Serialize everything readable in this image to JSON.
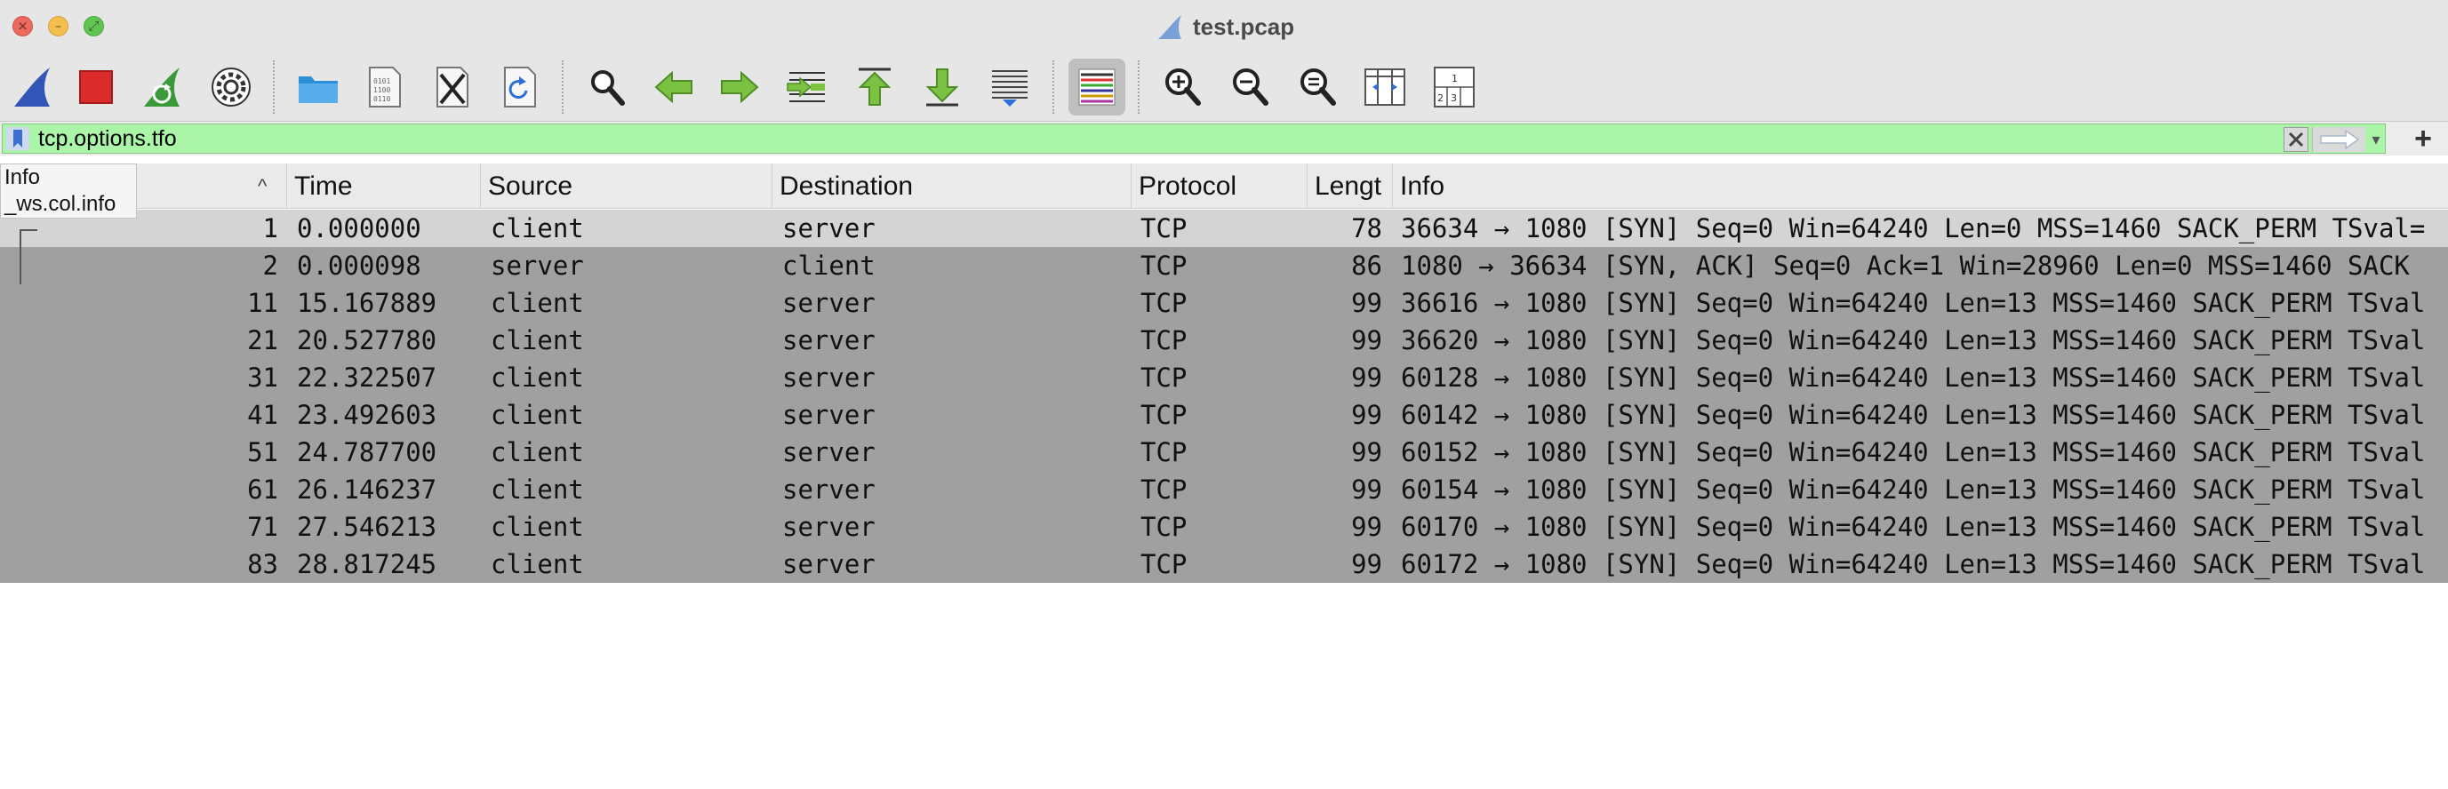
{
  "window": {
    "title": "test.pcap"
  },
  "toolbar": {
    "buttons": [
      {
        "name": "start-capture",
        "icon": "shark-fin-icon"
      },
      {
        "name": "stop-capture",
        "icon": "stop-icon"
      },
      {
        "name": "restart-capture",
        "icon": "restart-fin-icon"
      },
      {
        "name": "capture-options",
        "icon": "gear-icon"
      },
      {
        "name": "open-file",
        "icon": "folder-icon"
      },
      {
        "name": "save-file",
        "icon": "binary-file-icon"
      },
      {
        "name": "close-file",
        "icon": "close-file-icon"
      },
      {
        "name": "reload-file",
        "icon": "reload-icon"
      },
      {
        "name": "find-packet",
        "icon": "search-icon"
      },
      {
        "name": "go-back",
        "icon": "arrow-left-icon"
      },
      {
        "name": "go-forward",
        "icon": "arrow-right-icon"
      },
      {
        "name": "go-to-packet",
        "icon": "go-to-icon"
      },
      {
        "name": "first-packet",
        "icon": "arrow-up-icon"
      },
      {
        "name": "last-packet",
        "icon": "arrow-down-icon"
      },
      {
        "name": "auto-scroll",
        "icon": "autoscroll-icon"
      },
      {
        "name": "colorize",
        "icon": "colorize-icon",
        "active": true
      },
      {
        "name": "zoom-in",
        "icon": "zoom-in-icon"
      },
      {
        "name": "zoom-out",
        "icon": "zoom-out-icon"
      },
      {
        "name": "normal-size",
        "icon": "zoom-normal-icon"
      },
      {
        "name": "resize-columns",
        "icon": "resize-columns-icon"
      },
      {
        "name": "layout",
        "icon": "layout-icon",
        "digits": [
          "1",
          "2",
          "3"
        ]
      }
    ]
  },
  "filter": {
    "value": "tcp.options.tfo",
    "background_color": "#aaf5a8",
    "add_button": "+"
  },
  "columns": {
    "no": "",
    "time": "Time",
    "source": "Source",
    "destination": "Destination",
    "protocol": "Protocol",
    "length": "Lengt",
    "info": "Info",
    "sort_indicator": "^"
  },
  "tooltip": {
    "title": "Info",
    "field": "_ws.col.info"
  },
  "packets": [
    {
      "no": "1",
      "time": "0.000000",
      "source": "client",
      "destination": "server",
      "protocol": "TCP",
      "length": "78",
      "info": "36634 → 1080 [SYN] Seq=0 Win=64240 Len=0 MSS=1460 SACK_PERM TSval=",
      "selected": true
    },
    {
      "no": "2",
      "time": "0.000098",
      "source": "server",
      "destination": "client",
      "protocol": "TCP",
      "length": "86",
      "info": "1080 → 36634 [SYN, ACK] Seq=0 Ack=1 Win=28960 Len=0 MSS=1460 SACK",
      "selected": false
    },
    {
      "no": "11",
      "time": "15.167889",
      "source": "client",
      "destination": "server",
      "protocol": "TCP",
      "length": "99",
      "info": "36616 → 1080 [SYN] Seq=0 Win=64240 Len=13 MSS=1460 SACK_PERM TSval",
      "selected": false
    },
    {
      "no": "21",
      "time": "20.527780",
      "source": "client",
      "destination": "server",
      "protocol": "TCP",
      "length": "99",
      "info": "36620 → 1080 [SYN] Seq=0 Win=64240 Len=13 MSS=1460 SACK_PERM TSval",
      "selected": false
    },
    {
      "no": "31",
      "time": "22.322507",
      "source": "client",
      "destination": "server",
      "protocol": "TCP",
      "length": "99",
      "info": "60128 → 1080 [SYN] Seq=0 Win=64240 Len=13 MSS=1460 SACK_PERM TSval",
      "selected": false
    },
    {
      "no": "41",
      "time": "23.492603",
      "source": "client",
      "destination": "server",
      "protocol": "TCP",
      "length": "99",
      "info": "60142 → 1080 [SYN] Seq=0 Win=64240 Len=13 MSS=1460 SACK_PERM TSval",
      "selected": false
    },
    {
      "no": "51",
      "time": "24.787700",
      "source": "client",
      "destination": "server",
      "protocol": "TCP",
      "length": "99",
      "info": "60152 → 1080 [SYN] Seq=0 Win=64240 Len=13 MSS=1460 SACK_PERM TSval",
      "selected": false
    },
    {
      "no": "61",
      "time": "26.146237",
      "source": "client",
      "destination": "server",
      "protocol": "TCP",
      "length": "99",
      "info": "60154 → 1080 [SYN] Seq=0 Win=64240 Len=13 MSS=1460 SACK_PERM TSval",
      "selected": false
    },
    {
      "no": "71",
      "time": "27.546213",
      "source": "client",
      "destination": "server",
      "protocol": "TCP",
      "length": "99",
      "info": "60170 → 1080 [SYN] Seq=0 Win=64240 Len=13 MSS=1460 SACK_PERM TSval",
      "selected": false
    },
    {
      "no": "83",
      "time": "28.817245",
      "source": "client",
      "destination": "server",
      "protocol": "TCP",
      "length": "99",
      "info": "60172 → 1080 [SYN] Seq=0 Win=64240 Len=13 MSS=1460 SACK_PERM TSval",
      "selected": false
    }
  ],
  "colors": {
    "row_background": "#a0a0a0",
    "selected_row": "#d4d4d4",
    "toolbar": "#e6e6e6"
  }
}
